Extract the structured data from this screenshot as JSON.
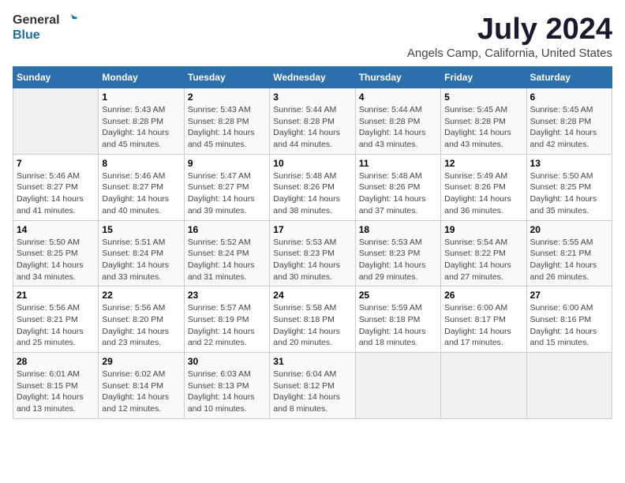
{
  "logo": {
    "text_general": "General",
    "text_blue": "Blue"
  },
  "title": "July 2024",
  "subtitle": "Angels Camp, California, United States",
  "headers": [
    "Sunday",
    "Monday",
    "Tuesday",
    "Wednesday",
    "Thursday",
    "Friday",
    "Saturday"
  ],
  "weeks": [
    [
      {
        "day": "",
        "info": "",
        "empty": true
      },
      {
        "day": "1",
        "info": "Sunrise: 5:43 AM\nSunset: 8:28 PM\nDaylight: 14 hours\nand 45 minutes."
      },
      {
        "day": "2",
        "info": "Sunrise: 5:43 AM\nSunset: 8:28 PM\nDaylight: 14 hours\nand 45 minutes."
      },
      {
        "day": "3",
        "info": "Sunrise: 5:44 AM\nSunset: 8:28 PM\nDaylight: 14 hours\nand 44 minutes."
      },
      {
        "day": "4",
        "info": "Sunrise: 5:44 AM\nSunset: 8:28 PM\nDaylight: 14 hours\nand 43 minutes."
      },
      {
        "day": "5",
        "info": "Sunrise: 5:45 AM\nSunset: 8:28 PM\nDaylight: 14 hours\nand 43 minutes."
      },
      {
        "day": "6",
        "info": "Sunrise: 5:45 AM\nSunset: 8:28 PM\nDaylight: 14 hours\nand 42 minutes."
      }
    ],
    [
      {
        "day": "7",
        "info": "Sunrise: 5:46 AM\nSunset: 8:27 PM\nDaylight: 14 hours\nand 41 minutes."
      },
      {
        "day": "8",
        "info": "Sunrise: 5:46 AM\nSunset: 8:27 PM\nDaylight: 14 hours\nand 40 minutes."
      },
      {
        "day": "9",
        "info": "Sunrise: 5:47 AM\nSunset: 8:27 PM\nDaylight: 14 hours\nand 39 minutes."
      },
      {
        "day": "10",
        "info": "Sunrise: 5:48 AM\nSunset: 8:26 PM\nDaylight: 14 hours\nand 38 minutes."
      },
      {
        "day": "11",
        "info": "Sunrise: 5:48 AM\nSunset: 8:26 PM\nDaylight: 14 hours\nand 37 minutes."
      },
      {
        "day": "12",
        "info": "Sunrise: 5:49 AM\nSunset: 8:26 PM\nDaylight: 14 hours\nand 36 minutes."
      },
      {
        "day": "13",
        "info": "Sunrise: 5:50 AM\nSunset: 8:25 PM\nDaylight: 14 hours\nand 35 minutes."
      }
    ],
    [
      {
        "day": "14",
        "info": "Sunrise: 5:50 AM\nSunset: 8:25 PM\nDaylight: 14 hours\nand 34 minutes."
      },
      {
        "day": "15",
        "info": "Sunrise: 5:51 AM\nSunset: 8:24 PM\nDaylight: 14 hours\nand 33 minutes."
      },
      {
        "day": "16",
        "info": "Sunrise: 5:52 AM\nSunset: 8:24 PM\nDaylight: 14 hours\nand 31 minutes."
      },
      {
        "day": "17",
        "info": "Sunrise: 5:53 AM\nSunset: 8:23 PM\nDaylight: 14 hours\nand 30 minutes."
      },
      {
        "day": "18",
        "info": "Sunrise: 5:53 AM\nSunset: 8:23 PM\nDaylight: 14 hours\nand 29 minutes."
      },
      {
        "day": "19",
        "info": "Sunrise: 5:54 AM\nSunset: 8:22 PM\nDaylight: 14 hours\nand 27 minutes."
      },
      {
        "day": "20",
        "info": "Sunrise: 5:55 AM\nSunset: 8:21 PM\nDaylight: 14 hours\nand 26 minutes."
      }
    ],
    [
      {
        "day": "21",
        "info": "Sunrise: 5:56 AM\nSunset: 8:21 PM\nDaylight: 14 hours\nand 25 minutes."
      },
      {
        "day": "22",
        "info": "Sunrise: 5:56 AM\nSunset: 8:20 PM\nDaylight: 14 hours\nand 23 minutes."
      },
      {
        "day": "23",
        "info": "Sunrise: 5:57 AM\nSunset: 8:19 PM\nDaylight: 14 hours\nand 22 minutes."
      },
      {
        "day": "24",
        "info": "Sunrise: 5:58 AM\nSunset: 8:18 PM\nDaylight: 14 hours\nand 20 minutes."
      },
      {
        "day": "25",
        "info": "Sunrise: 5:59 AM\nSunset: 8:18 PM\nDaylight: 14 hours\nand 18 minutes."
      },
      {
        "day": "26",
        "info": "Sunrise: 6:00 AM\nSunset: 8:17 PM\nDaylight: 14 hours\nand 17 minutes."
      },
      {
        "day": "27",
        "info": "Sunrise: 6:00 AM\nSunset: 8:16 PM\nDaylight: 14 hours\nand 15 minutes."
      }
    ],
    [
      {
        "day": "28",
        "info": "Sunrise: 6:01 AM\nSunset: 8:15 PM\nDaylight: 14 hours\nand 13 minutes."
      },
      {
        "day": "29",
        "info": "Sunrise: 6:02 AM\nSunset: 8:14 PM\nDaylight: 14 hours\nand 12 minutes."
      },
      {
        "day": "30",
        "info": "Sunrise: 6:03 AM\nSunset: 8:13 PM\nDaylight: 14 hours\nand 10 minutes."
      },
      {
        "day": "31",
        "info": "Sunrise: 6:04 AM\nSunset: 8:12 PM\nDaylight: 14 hours\nand 8 minutes."
      },
      {
        "day": "",
        "info": "",
        "empty": true
      },
      {
        "day": "",
        "info": "",
        "empty": true
      },
      {
        "day": "",
        "info": "",
        "empty": true
      }
    ]
  ]
}
